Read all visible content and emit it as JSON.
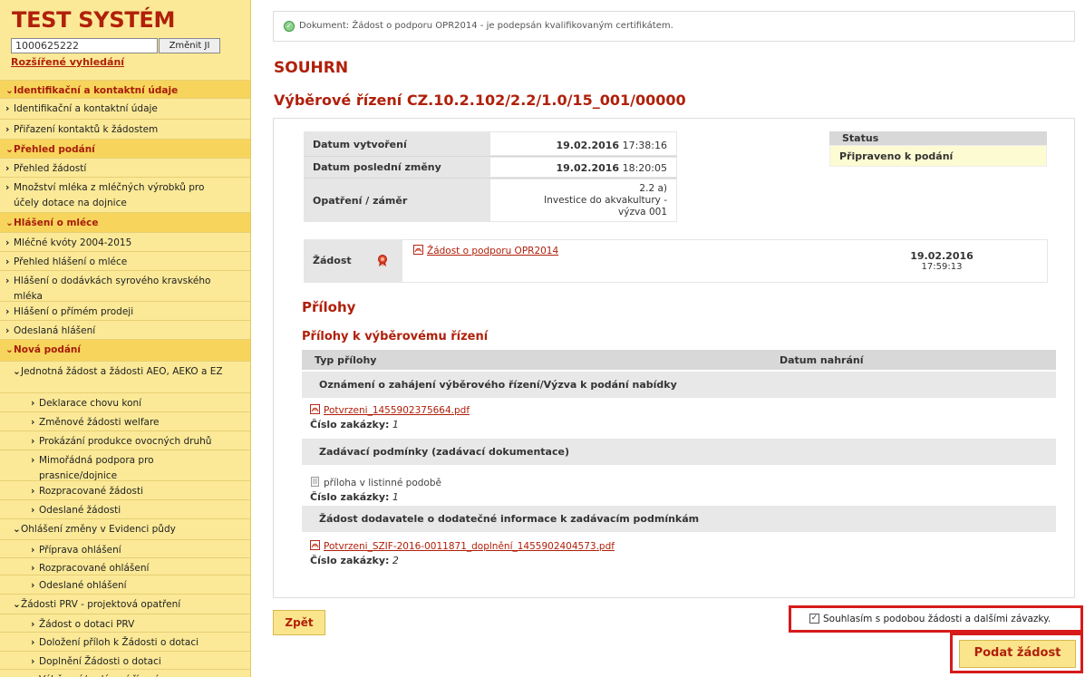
{
  "sidebar": {
    "title": "TEST SYSTÉM",
    "ji_value": "1000625222",
    "ji_button": "Změnit JI",
    "advanced_search": "Rozšířené vyhledání",
    "items": [
      {
        "label": "Identifikační a kontaktní údaje",
        "type": "section"
      },
      {
        "label": "Identifikační a kontaktní údaje",
        "type": "item"
      },
      {
        "label": "Přiřazení kontaktů k žádostem",
        "type": "item"
      },
      {
        "label": "Přehled podání",
        "type": "section"
      },
      {
        "label": "Přehled žádostí",
        "type": "item"
      },
      {
        "label": "Množství mléka z mléčných výrobků pro účely dotace na dojnice",
        "type": "item"
      },
      {
        "label": "Hlášení o mléce",
        "type": "section"
      },
      {
        "label": "Mléčné kvóty 2004-2015",
        "type": "item"
      },
      {
        "label": "Přehled hlášení o mléce",
        "type": "item"
      },
      {
        "label": "Hlášení o dodávkách syrového kravského mléka",
        "type": "item"
      },
      {
        "label": "Hlášení o přímém prodeji",
        "type": "item"
      },
      {
        "label": "Odeslaná hlášení",
        "type": "item"
      },
      {
        "label": "Nová podání",
        "type": "section"
      },
      {
        "label": "Jednotná žádost a žádosti AEO, AEKO a EZ",
        "type": "group"
      },
      {
        "label": "Deklarace chovu koní",
        "type": "sub"
      },
      {
        "label": "Změnové žádosti welfare",
        "type": "sub"
      },
      {
        "label": "Prokázání produkce ovocných druhů",
        "type": "sub"
      },
      {
        "label": "Mimořádná podpora pro prasnice/dojnice",
        "type": "sub"
      },
      {
        "label": "Rozpracované žádosti",
        "type": "sub"
      },
      {
        "label": "Odeslané žádosti",
        "type": "sub"
      },
      {
        "label": "Ohlášení změny v Evidenci půdy",
        "type": "group"
      },
      {
        "label": "Příprava ohlášení",
        "type": "sub"
      },
      {
        "label": "Rozpracované ohlášení",
        "type": "sub"
      },
      {
        "label": "Odeslané ohlášení",
        "type": "sub"
      },
      {
        "label": "Žádosti PRV - projektová opatření",
        "type": "group"
      },
      {
        "label": "Žádost o dotaci PRV",
        "type": "sub"
      },
      {
        "label": "Doložení příloh k Žádosti o dotaci",
        "type": "sub"
      },
      {
        "label": "Doplnění Žádosti o dotaci",
        "type": "sub"
      },
      {
        "label": "Výběrová/zadávací řízení",
        "type": "sub"
      }
    ]
  },
  "notice": "Dokument: Žádost o podporu OPR2014 - je podepsán kvalifikovaným certifikátem.",
  "heading": "SOUHRN",
  "subheading": "Výběrové řízení CZ.10.2.102/2.2/1.0/15_001/00000",
  "info": {
    "created_label": "Datum vytvoření",
    "created_date": "19.02.2016",
    "created_time": "17:38:16",
    "modified_label": "Datum poslední změny",
    "modified_date": "19.02.2016",
    "modified_time": "18:20:05",
    "measure_label": "Opatření / záměr",
    "measure_line1": "2.2 a)",
    "measure_line2": "Investice do akvakultury -",
    "measure_line3": "výzva 001"
  },
  "status": {
    "label": "Status",
    "value": "Připraveno k podání"
  },
  "zadost": {
    "label": "Žádost",
    "link": "Žádost o podporu OPR2014",
    "date": "19.02.2016",
    "time": "17:59:13"
  },
  "prilohy": {
    "heading": "Přílohy",
    "subheading": "Přílohy k výběrovému řízení",
    "col_type": "Typ přílohy",
    "col_date": "Datum nahrání",
    "groups": [
      {
        "title": "Oznámení o zahájení výběrového řízení/Výzva k podání nabídky",
        "file": "Potvrzeni_1455902375664.pdf",
        "order_label": "Číslo zakázky:",
        "order_num": "1"
      },
      {
        "title": "Zadávací podmínky (zadávací dokumentace)",
        "file": "příloha v listinné podobě",
        "order_label": "Číslo zakázky:",
        "order_num": "1"
      },
      {
        "title": "Žádost dodavatele o dodatečné informace k zadávacím podmínkám",
        "file": "Potvrzeni_SZIF-2016-0011871_doplnění_1455902404573.pdf",
        "order_label": "Číslo zakázky:",
        "order_num": "2"
      }
    ]
  },
  "buttons": {
    "back": "Zpět",
    "consent": "Souhlasím s podobou žádosti a dalšími závazky.",
    "submit": "Podat žádost"
  }
}
